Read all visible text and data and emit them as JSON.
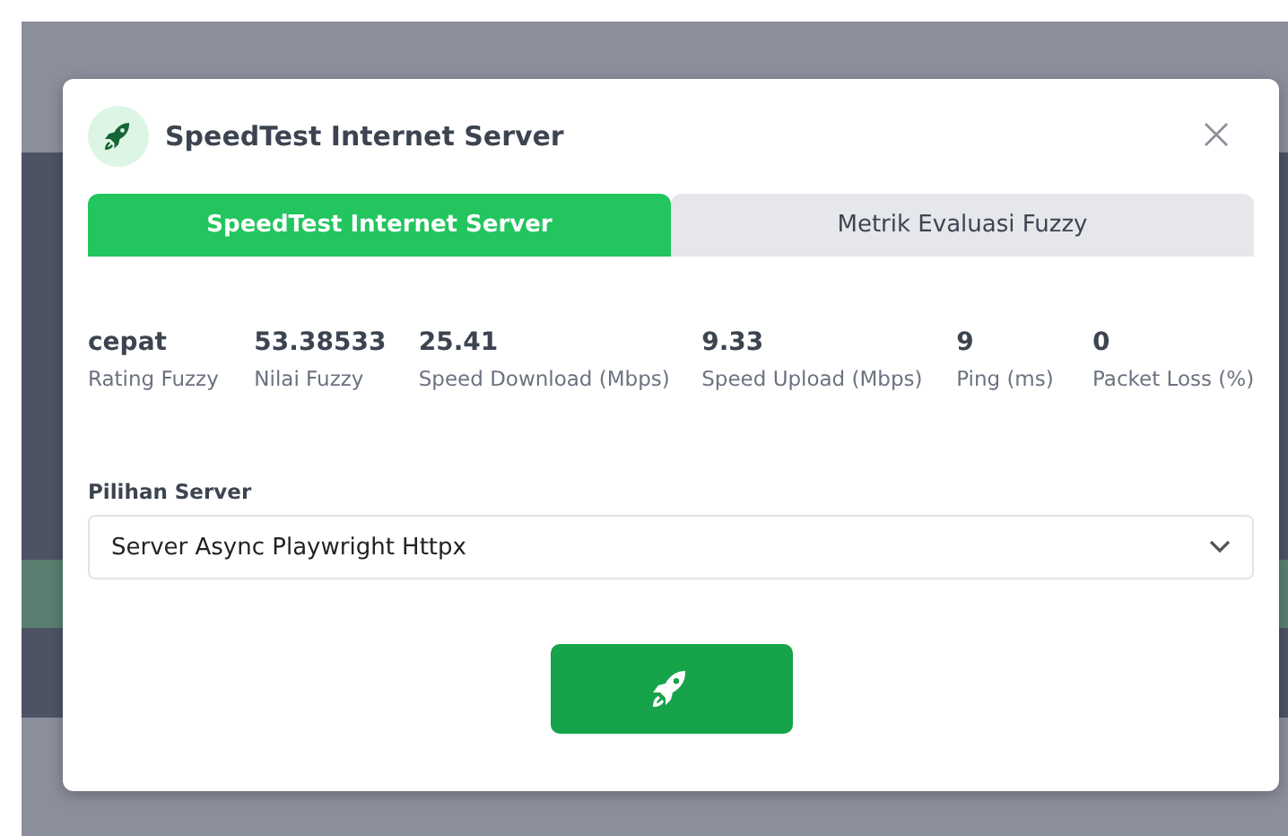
{
  "dialog": {
    "title": "SpeedTest Internet Server"
  },
  "tabs": [
    {
      "label": "SpeedTest Internet Server",
      "selected": true
    },
    {
      "label": "Metrik Evaluasi Fuzzy",
      "selected": false
    }
  ],
  "stats": [
    {
      "value": "cepat",
      "label": "Rating Fuzzy"
    },
    {
      "value": "53.38533",
      "label": "Nilai Fuzzy"
    },
    {
      "value": "25.41",
      "label": "Speed Download (Mbps)"
    },
    {
      "value": "9.33",
      "label": "Speed Upload (Mbps)"
    },
    {
      "value": "9",
      "label": "Ping (ms)"
    },
    {
      "value": "0",
      "label": "Packet Loss (%)"
    }
  ],
  "server_select": {
    "label": "Pilihan Server",
    "value": "Server Async Playwright Httpx"
  }
}
